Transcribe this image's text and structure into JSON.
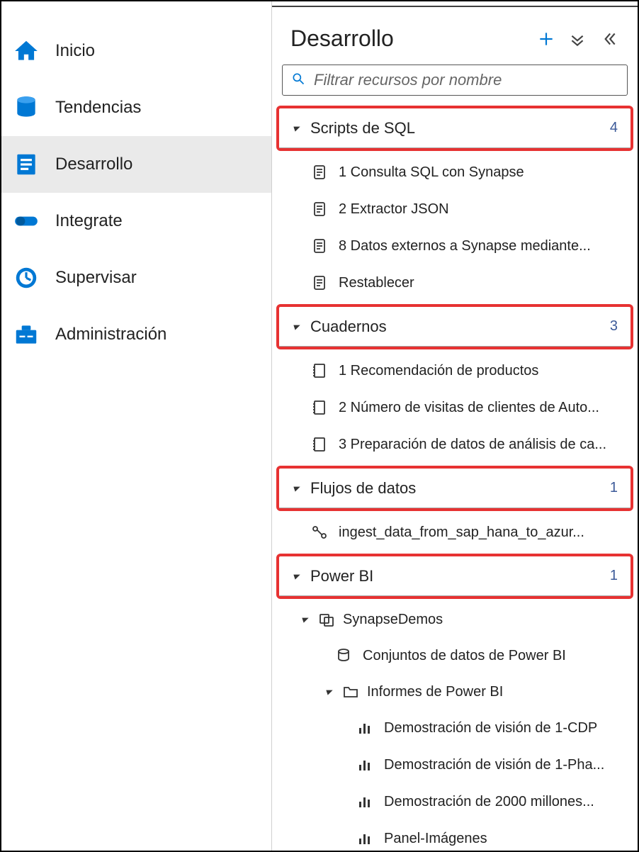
{
  "sidebar": {
    "items": [
      {
        "label": "Inicio",
        "active": false
      },
      {
        "label": "Tendencias",
        "active": false
      },
      {
        "label": "Desarrollo",
        "active": true
      },
      {
        "label": "Integrate",
        "active": false
      },
      {
        "label": "Supervisar",
        "active": false
      },
      {
        "label": "Administración",
        "active": false
      }
    ]
  },
  "main": {
    "title": "Desarrollo",
    "search_placeholder": "Filtrar recursos por nombre",
    "groups": {
      "sql": {
        "label": "Scripts de SQL",
        "count": "4",
        "items": [
          "1 Consulta SQL con Synapse",
          "2 Extractor JSON",
          "8 Datos externos a Synapse mediante...",
          "Restablecer"
        ]
      },
      "notebooks": {
        "label": "Cuadernos",
        "count": "3",
        "items": [
          "1 Recomendación de productos",
          "2 Número de visitas de clientes de Auto...",
          "3 Preparación de datos de análisis de ca..."
        ]
      },
      "dataflows": {
        "label": "Flujos de datos",
        "count": "1",
        "items": [
          "ingest_data_from_sap_hana_to_azur..."
        ]
      },
      "powerbi": {
        "label": "Power BI",
        "count": "1",
        "workspace": "SynapseDemos",
        "datasets_label": "Conjuntos de datos de Power BI",
        "reports_label": "Informes de Power BI",
        "reports": [
          "Demostración de visión de 1-CDP",
          "Demostración de visión de 1-Pha...",
          "Demostración de 2000 millones...",
          "Panel-Imágenes"
        ]
      }
    }
  }
}
